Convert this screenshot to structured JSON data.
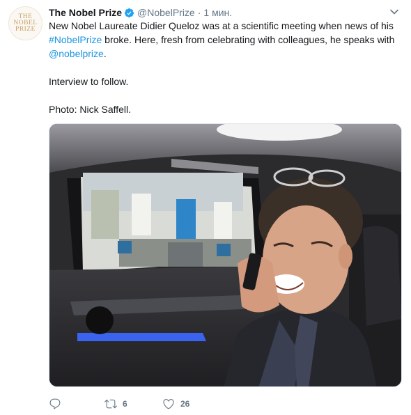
{
  "author": {
    "avatar_text": "THE\nNOBEL\nPRIZE",
    "name": "The Nobel Prize",
    "handle": "@NobelPrize",
    "separator": "·",
    "time": "1 мин."
  },
  "tweet": {
    "line1_pre": "New Nobel Laureate Didier Queloz was at a scientific meeting when news of his ",
    "hashtag": "#NobelPrize",
    "line1_post": " broke. Here, fresh from celebrating with colleagues, he speaks with ",
    "mention": "@nobelprize",
    "line1_end": ".",
    "para2": "Interview to follow.",
    "para3": "Photo: Nick Saffell."
  },
  "actions": {
    "reply_count": "",
    "retweet_count": "6",
    "like_count": "26"
  },
  "colors": {
    "link": "#1b95e0",
    "verified": "#1da1f2",
    "muted": "#657786"
  },
  "icons": [
    "verified-badge-icon",
    "chevron-down-icon",
    "reply-icon",
    "retweet-icon",
    "like-icon"
  ]
}
